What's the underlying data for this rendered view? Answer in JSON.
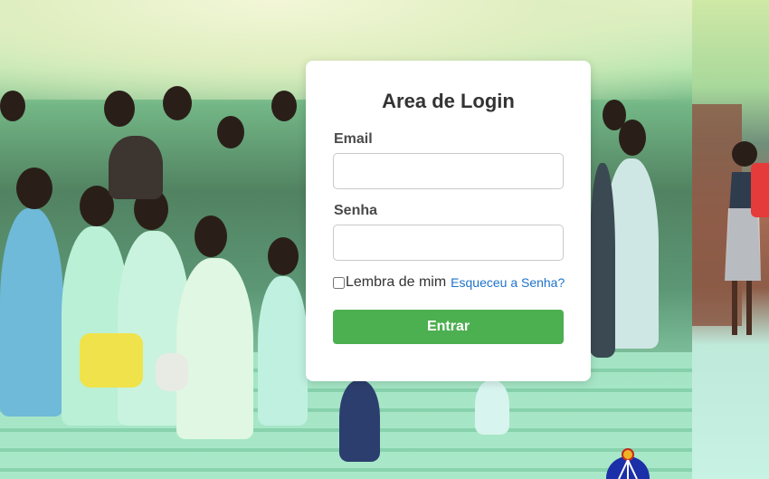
{
  "login": {
    "title": "Area de Login",
    "email_label": "Email",
    "email_value": "",
    "password_label": "Senha",
    "password_value": "",
    "remember_label": "Lembra de mim",
    "forgot_link": "Esqueceu a Senha?",
    "submit_label": "Entrar"
  },
  "colors": {
    "submit_button": "#4caf50",
    "link": "#1e73c8",
    "card_background": "#ffffff"
  }
}
